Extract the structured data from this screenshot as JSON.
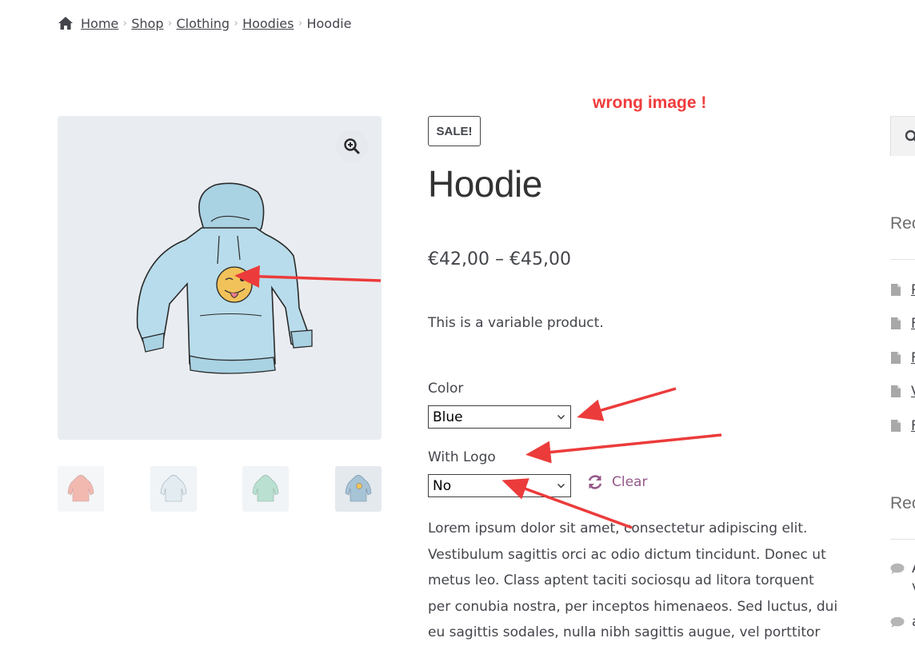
{
  "breadcrumb": {
    "items": [
      "Home",
      "Shop",
      "Clothing",
      "Hoodies"
    ],
    "current": "Hoodie"
  },
  "annotation": "wrong image !",
  "product": {
    "badge": "SALE!",
    "title": "Hoodie",
    "price": "€42,00 – €45,00",
    "short_description": "This is a variable product.",
    "variations": [
      {
        "label": "Color",
        "selected": "Blue"
      },
      {
        "label": "With Logo",
        "selected": "No"
      }
    ],
    "clear_label": "Clear",
    "description": "Lorem ipsum dolor sit amet, consectetur adipiscing elit. Vestibulum sagittis orci ac odio dictum tincidunt. Donec ut metus leo. Class aptent taciti sociosqu ad litora torquent per conubia nostra, per inceptos himenaeos. Sed luctus, dui eu sagittis sodales, nulla nibh sagittis augue, vel porttitor diam"
  },
  "thumbnails": [
    {
      "name": "pink-hoodie",
      "color": "#f2b9b0"
    },
    {
      "name": "white-hoodie",
      "color": "#dfe8ee"
    },
    {
      "name": "green-hoodie",
      "color": "#b9e0d0"
    },
    {
      "name": "blue-hoodie-logo",
      "color": "#a7c3d6"
    }
  ],
  "sidebar": {
    "widget_titles": [
      "Rec",
      "Rec"
    ],
    "doc_links": [
      "R",
      "F",
      "F",
      "V",
      "F"
    ],
    "comments": [
      {
        "line1": "A",
        "line2": "v"
      },
      {
        "line1": "a",
        "line2": ""
      }
    ]
  },
  "colors": {
    "accent": "#96588a",
    "annotation": "#f03c3c",
    "text": "#43454b"
  }
}
